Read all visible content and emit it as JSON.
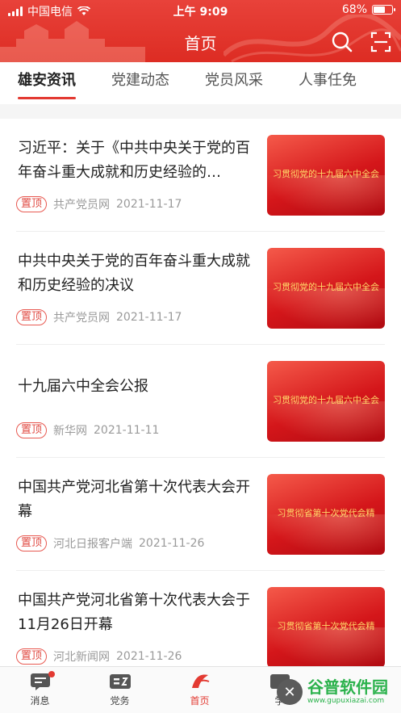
{
  "status_bar": {
    "carrier": "中国电信",
    "time": "上午 9:09",
    "battery": "68%",
    "battery_level": 0.68
  },
  "nav": {
    "title": "首页",
    "icons": [
      "search-icon",
      "scan-icon"
    ]
  },
  "tabs": [
    {
      "label": "雄安资讯",
      "active": true
    },
    {
      "label": "党建动态",
      "active": false
    },
    {
      "label": "党员风采",
      "active": false
    },
    {
      "label": "人事任免",
      "active": false
    }
  ],
  "articles": [
    {
      "title": "习近平：关于《中共中央关于党的百年奋斗重大成就和历史经验的…",
      "pin": "置顶",
      "source": "共产党员网",
      "date": "2021-11-17",
      "thumb_caption": "习贯彻党的十九届六中全会"
    },
    {
      "title": "中共中央关于党的百年奋斗重大成就和历史经验的决议",
      "pin": "置顶",
      "source": "共产党员网",
      "date": "2021-11-17",
      "thumb_caption": "习贯彻党的十九届六中全会"
    },
    {
      "title": "十九届六中全会公报",
      "pin": "置顶",
      "source": "新华网",
      "date": "2021-11-11",
      "thumb_caption": "习贯彻党的十九届六中全会"
    },
    {
      "title": "中国共产党河北省第十次代表大会开幕",
      "pin": "置顶",
      "source": "河北日报客户端",
      "date": "2021-11-26",
      "thumb_caption": "习贯彻省第十次党代会精"
    },
    {
      "title": "中国共产党河北省第十次代表大会于11月26日开幕",
      "pin": "置顶",
      "source": "河北新闻网",
      "date": "2021-11-26",
      "thumb_caption": "习贯彻省第十次党代会精"
    }
  ],
  "tabbar": [
    {
      "label": "消息",
      "icon": "message-icon",
      "badge": true
    },
    {
      "label": "党务",
      "icon": "party-affairs-icon",
      "badge": false
    },
    {
      "label": "首页",
      "icon": "home-logo-icon",
      "active": true
    },
    {
      "label": "学",
      "icon": "study-icon",
      "badge": false
    }
  ],
  "watermark": {
    "title": "谷普软件园",
    "url": "www.gupuxiazai.com"
  },
  "colors": {
    "accent": "#e33a32",
    "header": "#dd2c23"
  }
}
